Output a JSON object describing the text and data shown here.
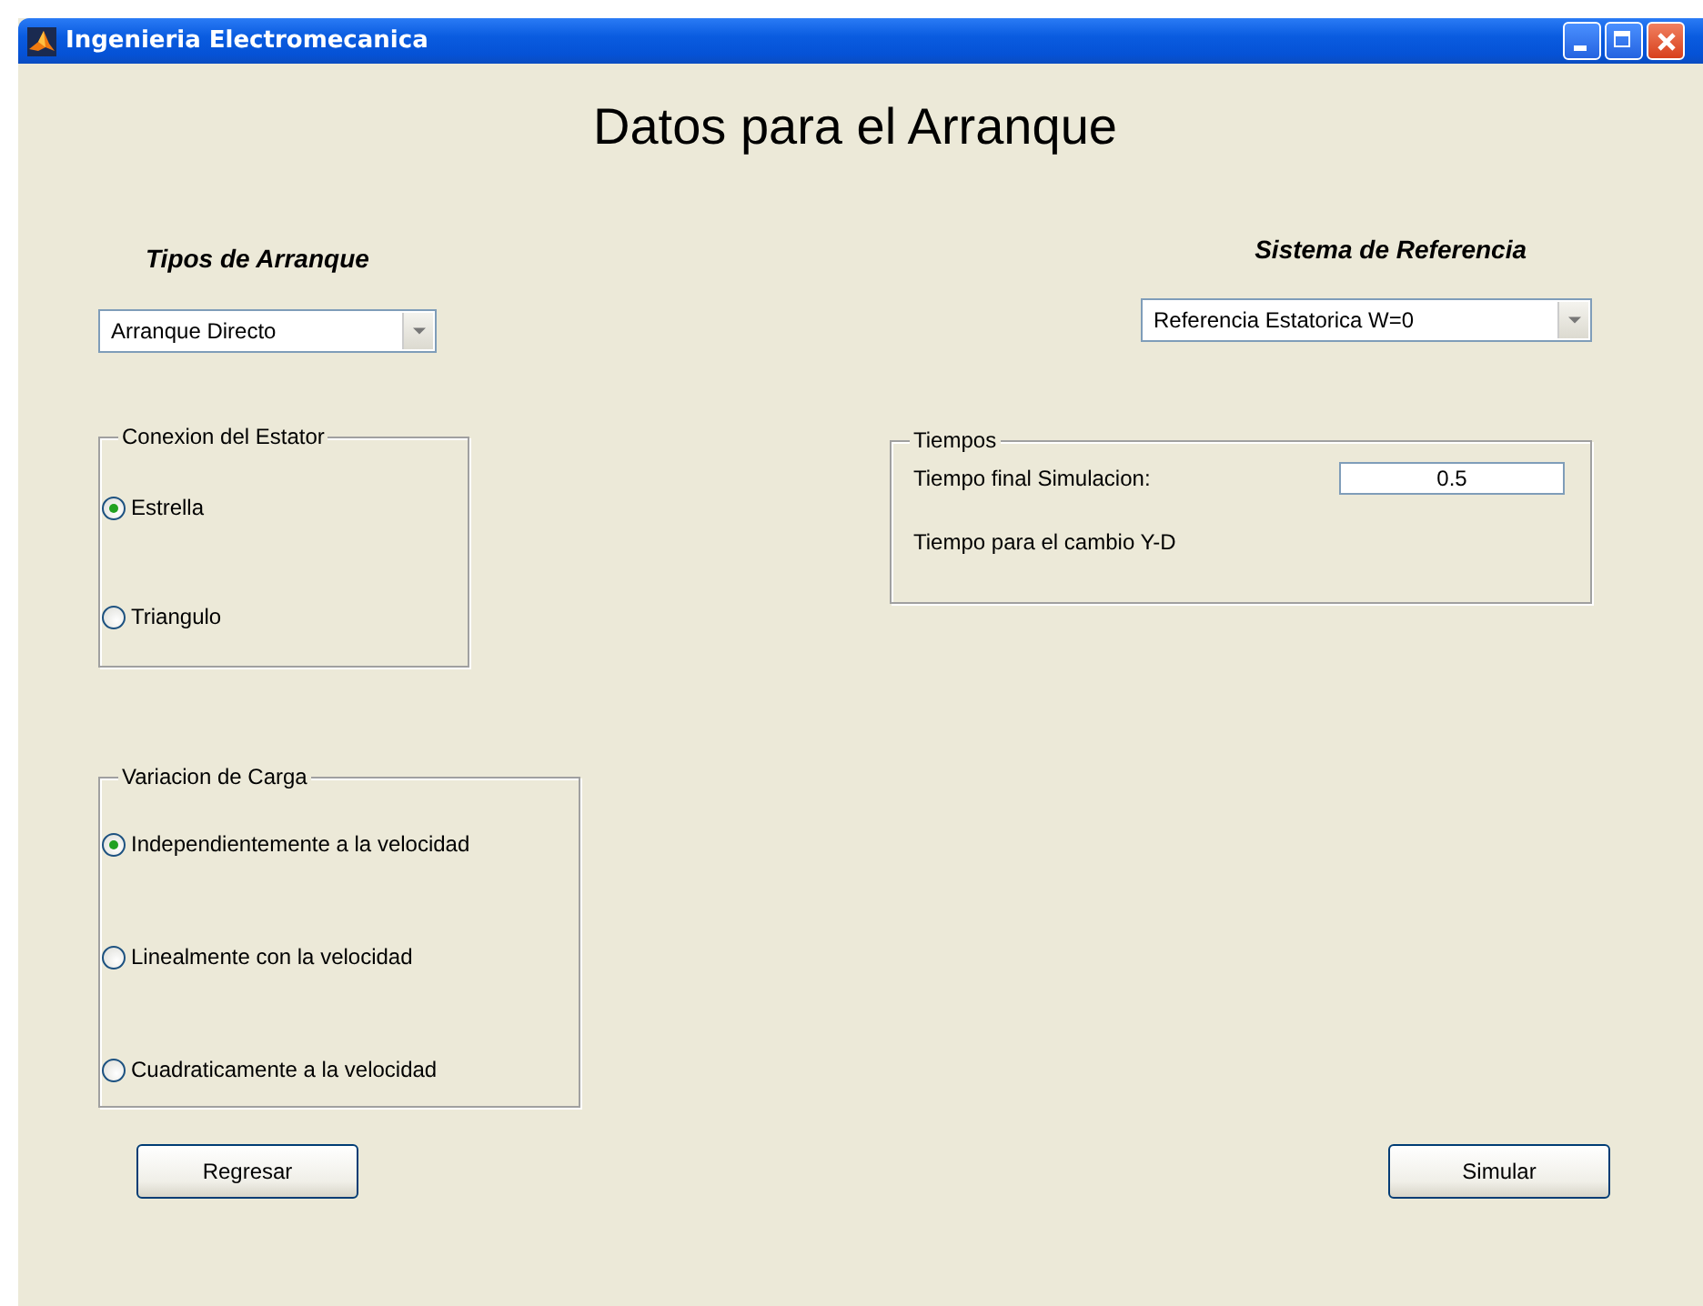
{
  "window": {
    "title": "Ingenieria Electromecanica"
  },
  "heading": "Datos para el Arranque",
  "start_type": {
    "label": "Tipos de Arranque",
    "dropdown": "Arranque Directo"
  },
  "stator_connection": {
    "legend": "Conexion del Estator",
    "options": [
      {
        "label": "Estrella",
        "selected": true
      },
      {
        "label": "Triangulo",
        "selected": false
      }
    ]
  },
  "load_variation": {
    "legend": "Variacion de Carga",
    "options": [
      {
        "label": "Independientemente a la velocidad",
        "selected": true
      },
      {
        "label": "Linealmente con la velocidad",
        "selected": false
      },
      {
        "label": "Cuadraticamente a la velocidad",
        "selected": false
      }
    ]
  },
  "reference": {
    "label": "Sistema de Referencia",
    "dropdown": "Referencia Estatorica W=0"
  },
  "times": {
    "legend": "Tiempos",
    "fields": [
      {
        "label": "Tiempo final Simulacion:",
        "value": "0.5"
      },
      {
        "label": "Tiempo para el cambio Y-D"
      }
    ]
  },
  "buttons": [
    {
      "label": "Regresar"
    },
    {
      "label": "Simular"
    }
  ]
}
